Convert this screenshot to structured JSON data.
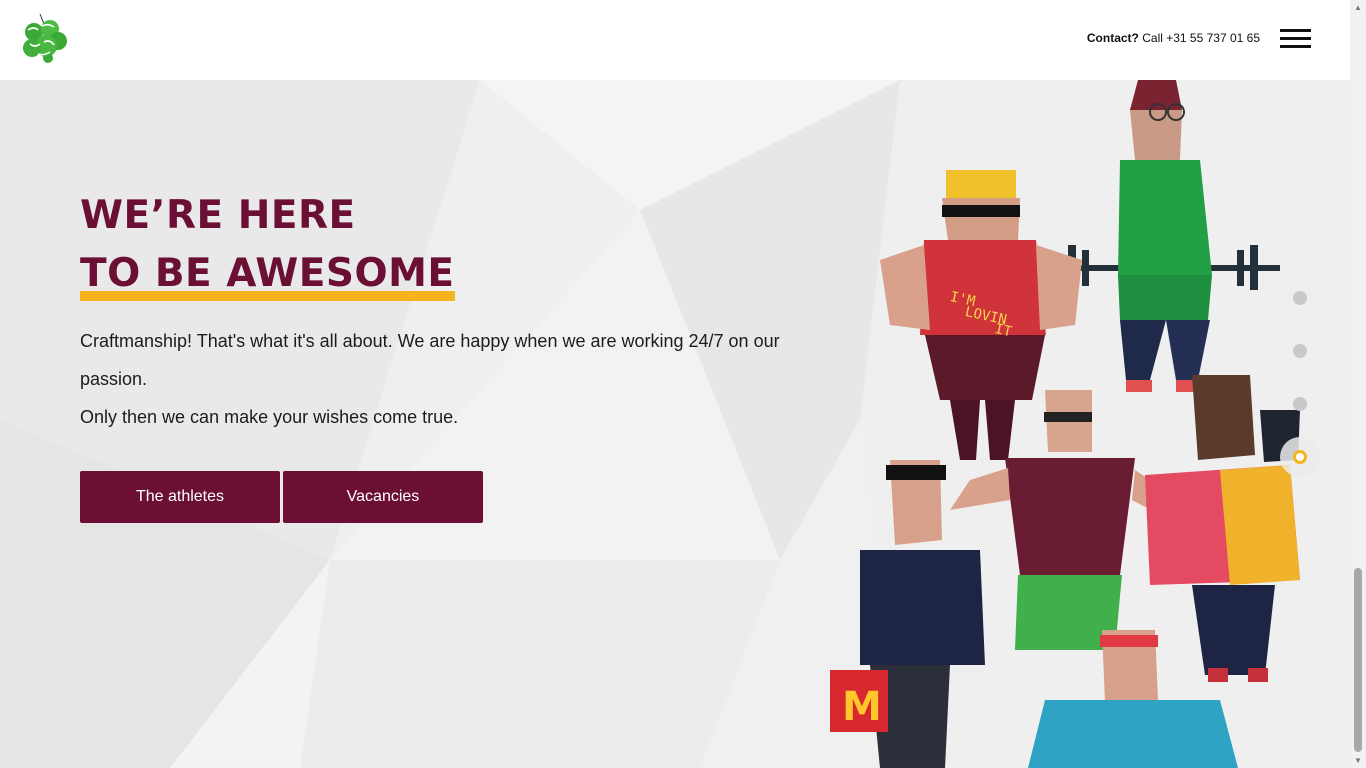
{
  "header": {
    "logo_alt": "Best Relic",
    "contact_label": "Contact?",
    "contact_text": "Call +31 55 737 01 65",
    "menu_icon": "hamburger-icon"
  },
  "hero": {
    "title_line1": "WE’RE HERE",
    "title_line2": "TO BE AWESOME",
    "paragraph1": "Craftmanship! That's what it's all about. We are happy when we are working 24/7 on our passion.",
    "paragraph2": "Only then we can make your wishes come true.",
    "button_athletes": "The athletes",
    "button_vacancies": "Vacancies"
  },
  "illustration": {
    "shirt_text_line1": "I'M",
    "shirt_text_line2": "LOVIN",
    "shirt_text_line3": "IT"
  },
  "slider": {
    "total_slides": 4,
    "active_slide": 4
  },
  "colors": {
    "brand": "#6b0f34",
    "accent": "#f5b31d",
    "background": "#efefef",
    "logo_green": "#3aa935"
  }
}
